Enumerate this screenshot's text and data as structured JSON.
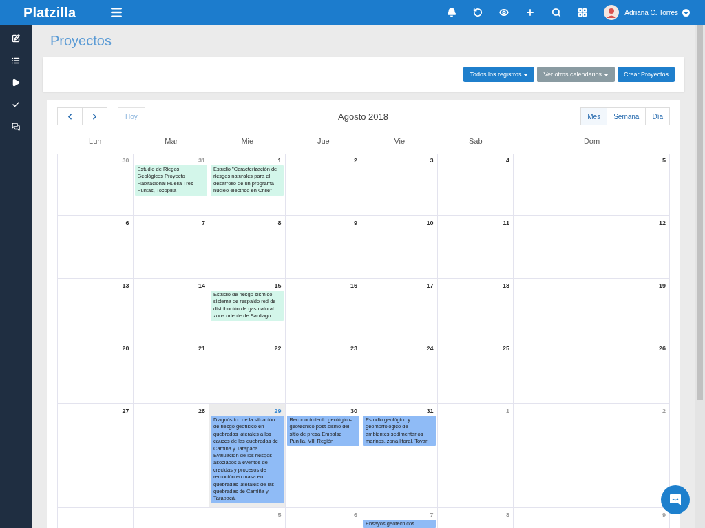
{
  "topbar": {
    "brand": "Platzilla",
    "user_name": "Adriana C. Torres"
  },
  "page_title": "Proyectos",
  "toolbar": {
    "buttons": [
      {
        "label": "Todos los registros",
        "kind": "primary",
        "caret": true
      },
      {
        "label": "Ver otros calendarios",
        "kind": "muted",
        "caret": true
      },
      {
        "label": "Crear Proyectos",
        "kind": "primary",
        "caret": false
      }
    ]
  },
  "calendar": {
    "title": "Agosto 2018",
    "today_label": "Hoy",
    "views": [
      {
        "label": "Mes",
        "selected": true
      },
      {
        "label": "Semana",
        "selected": false
      },
      {
        "label": "Día",
        "selected": false
      }
    ],
    "weekdays": [
      "Lun",
      "Mar",
      "Mie",
      "Jue",
      "Vie",
      "Sab",
      "Dom"
    ],
    "weeks": [
      {
        "days": [
          {
            "number": "30",
            "other_month": true,
            "today": false
          },
          {
            "number": "31",
            "other_month": true,
            "today": false,
            "events": [
              {
                "title": "Estudio de Riegos Geológicos Proyecto Habitacional Huella Tres Puntas, Tocopilla",
                "color": "#d3f6ea"
              }
            ]
          },
          {
            "number": "1",
            "other_month": false,
            "today": false,
            "events": [
              {
                "title": "Estudio \"Caracterización de riesgos naturales para el desarrollo de un programa núcleo-eléctrico en Chile\"",
                "color": "#d3f6ea"
              }
            ]
          },
          {
            "number": "2",
            "other_month": false,
            "today": false
          },
          {
            "number": "3",
            "other_month": false,
            "today": false
          },
          {
            "number": "4",
            "other_month": false,
            "today": false
          },
          {
            "number": "5",
            "other_month": false,
            "today": false
          }
        ]
      },
      {
        "days": [
          {
            "number": "6",
            "other_month": false,
            "today": false
          },
          {
            "number": "7",
            "other_month": false,
            "today": false
          },
          {
            "number": "8",
            "other_month": false,
            "today": false
          },
          {
            "number": "9",
            "other_month": false,
            "today": false
          },
          {
            "number": "10",
            "other_month": false,
            "today": false
          },
          {
            "number": "11",
            "other_month": false,
            "today": false
          },
          {
            "number": "12",
            "other_month": false,
            "today": false
          }
        ]
      },
      {
        "days": [
          {
            "number": "13",
            "other_month": false,
            "today": false
          },
          {
            "number": "14",
            "other_month": false,
            "today": false
          },
          {
            "number": "15",
            "other_month": false,
            "today": false,
            "events": [
              {
                "title": "Estudio de riesgo sísmico sistema de respaldo red de distribución de gas natural zona oriente de Santiago",
                "color": "#d3f6ea"
              }
            ]
          },
          {
            "number": "16",
            "other_month": false,
            "today": false
          },
          {
            "number": "17",
            "other_month": false,
            "today": false
          },
          {
            "number": "18",
            "other_month": false,
            "today": false
          },
          {
            "number": "19",
            "other_month": false,
            "today": false
          }
        ]
      },
      {
        "days": [
          {
            "number": "20",
            "other_month": false,
            "today": false
          },
          {
            "number": "21",
            "other_month": false,
            "today": false
          },
          {
            "number": "22",
            "other_month": false,
            "today": false
          },
          {
            "number": "23",
            "other_month": false,
            "today": false
          },
          {
            "number": "24",
            "other_month": false,
            "today": false
          },
          {
            "number": "25",
            "other_month": false,
            "today": false
          },
          {
            "number": "26",
            "other_month": false,
            "today": false
          }
        ]
      },
      {
        "days": [
          {
            "number": "27",
            "other_month": false,
            "today": false
          },
          {
            "number": "28",
            "other_month": false,
            "today": false
          },
          {
            "number": "29",
            "other_month": false,
            "today": true,
            "events": [
              {
                "title": "Diagnóstico de la situación de riesgo geofísico en quebradas laterales a los cauces de las quebradas de Camiña y Tarapacá. Evaluación de los riesgos asociados a eventos de crecidas y procesos de remoción en masa en quebradas laterales de las quebradas de Camiña y Tarapacá.",
                "color": "#8fbbf6"
              }
            ]
          },
          {
            "number": "30",
            "other_month": false,
            "today": false,
            "events": [
              {
                "title": "Reconocimiento geológico-geotécnico post-sismo del sitio de presa Embalse Punilla, VIII Región",
                "color": "#8fbbf6"
              }
            ]
          },
          {
            "number": "31",
            "other_month": false,
            "today": false,
            "events": [
              {
                "title": "Estudio geológico y geomorfológico de ambientes sedimentarios marinos, zona litoral. Tovar",
                "color": "#8fbbf6"
              }
            ]
          },
          {
            "number": "1",
            "other_month": true,
            "today": false
          },
          {
            "number": "2",
            "other_month": true,
            "today": false
          }
        ]
      },
      {
        "days": [
          {
            "today": false
          },
          {
            "today": false
          },
          {
            "number": "5",
            "other_month": true,
            "today": false
          },
          {
            "number": "6",
            "other_month": true,
            "today": false
          },
          {
            "number": "7",
            "other_month": true,
            "today": false,
            "events": [
              {
                "title": "Ensayos geotécnicos",
                "color": "#8fbbf6"
              }
            ]
          },
          {
            "number": "8",
            "other_month": true,
            "today": false
          },
          {
            "number": "9",
            "other_month": true,
            "today": false
          }
        ]
      }
    ]
  }
}
